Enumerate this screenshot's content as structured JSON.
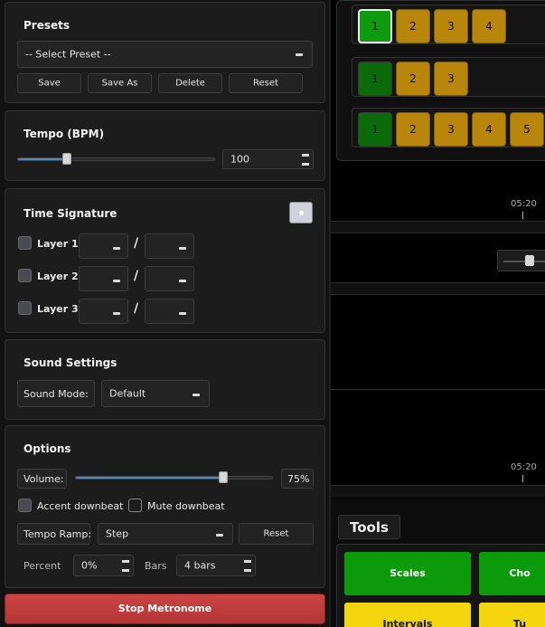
{
  "presets": {
    "title": "Presets",
    "select_value": "-- Select Preset --",
    "buttons": [
      "Save",
      "Save As",
      "Delete",
      "Reset"
    ]
  },
  "tempo": {
    "title": "Tempo (BPM)",
    "value": "100",
    "slider_fraction": 0.25
  },
  "time_signature": {
    "title": "Time Signature",
    "layers": [
      {
        "label": "Layer 1:",
        "sep": "/"
      },
      {
        "label": "Layer 2:",
        "sep": "/"
      },
      {
        "label": "Layer 3:",
        "sep": "/"
      }
    ]
  },
  "sound": {
    "title": "Sound Settings",
    "mode_label": "Sound Mode:",
    "mode_value": "Default"
  },
  "options": {
    "title": "Options",
    "volume_label": "Volume:",
    "volume_value": "75%",
    "volume_fraction": 0.75,
    "accent_label": "Accent downbeat",
    "mute_label": "Mute downbeat",
    "ramp_label": "Tempo Ramp:",
    "ramp_value": "Step",
    "ramp_reset": "Reset",
    "percent_label": "Percent",
    "percent_value": "0%",
    "bars_label": "Bars",
    "bars_value": "4 bars"
  },
  "stop_button": "Stop Metronome",
  "beats": {
    "row1": [
      "1",
      "2",
      "3",
      "4"
    ],
    "row2": [
      "1",
      "2",
      "3"
    ],
    "row3": [
      "1",
      "2",
      "3",
      "4",
      "5"
    ]
  },
  "timeline": {
    "label1": "05:20",
    "label2": "05:20"
  },
  "tools": {
    "title": "Tools",
    "items": [
      "Scales",
      "Cho",
      "Intervals",
      "Tu"
    ]
  },
  "colors": {
    "accent": "#4f86c6",
    "stop": "#cc4444",
    "beat_active": "#0f9a0f",
    "beat_inactive": "#b8860b",
    "tool_green": "#0a9a0a",
    "tool_yellow": "#f2d50c"
  }
}
